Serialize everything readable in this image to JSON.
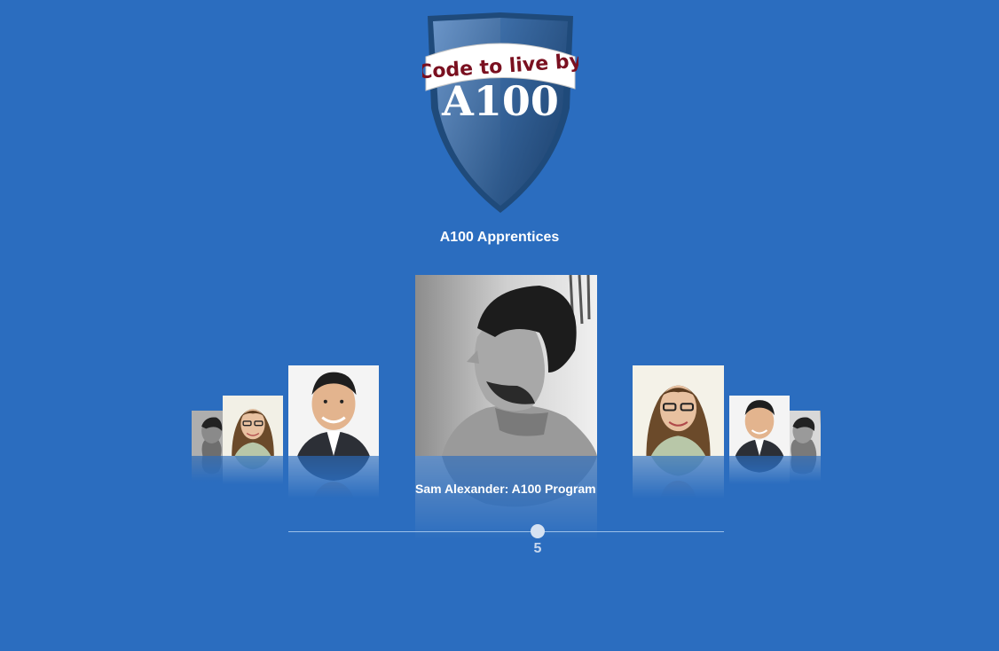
{
  "logo": {
    "tagline": "Code to live by",
    "brand": "A100"
  },
  "header": {
    "title": "A100 Apprentices"
  },
  "carousel": {
    "items": [
      {
        "kind": "profile-bw"
      },
      {
        "kind": "woman-glasses"
      },
      {
        "kind": "man-suit"
      },
      {
        "kind": "profile-bw"
      },
      {
        "kind": "woman-glasses"
      },
      {
        "kind": "man-suit"
      },
      {
        "kind": "profile-bw"
      }
    ],
    "active_index": 3,
    "caption": "Sam Alexander: A100 Program"
  },
  "slider": {
    "value": "5"
  },
  "colors": {
    "background": "#2b6dbf",
    "shield": "#2f5f96",
    "banner_text": "#7a1020"
  }
}
